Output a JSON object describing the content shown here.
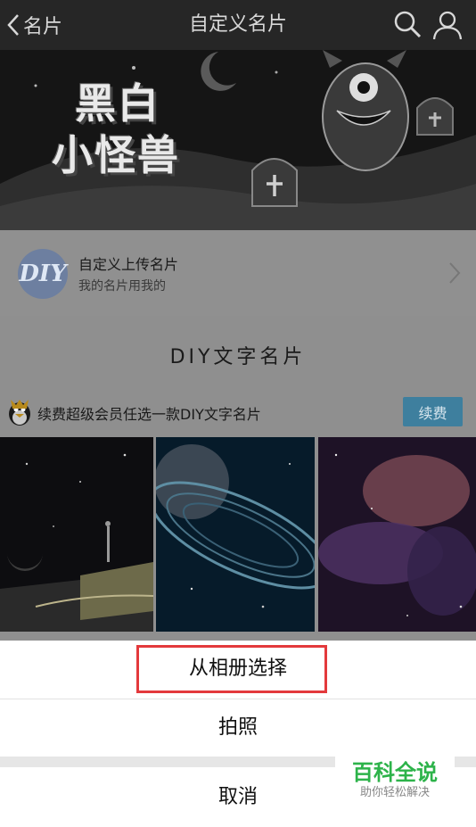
{
  "topbar": {
    "back_label": "名片",
    "title": "自定义名片"
  },
  "banner": {
    "text_line1": "黑白",
    "text_line2": "小怪兽"
  },
  "upload": {
    "logo_text": "DIY",
    "title": "自定义上传名片",
    "subtitle": "我的名片用我的"
  },
  "diy_section": {
    "heading": "DIY文字名片",
    "vip_text": "续费超级会员任选一款DIY文字名片",
    "renew_button": "续费"
  },
  "action_sheet": {
    "album_option": "从相册选择",
    "photo_option": "拍照",
    "cancel_option": "取消"
  },
  "watermark": {
    "title": "百科全说",
    "subtitle": "助你轻松解决"
  },
  "colors": {
    "highlight_border": "#e3393c",
    "renew_button": "#3e7f9e",
    "watermark_green": "#2db34a"
  }
}
